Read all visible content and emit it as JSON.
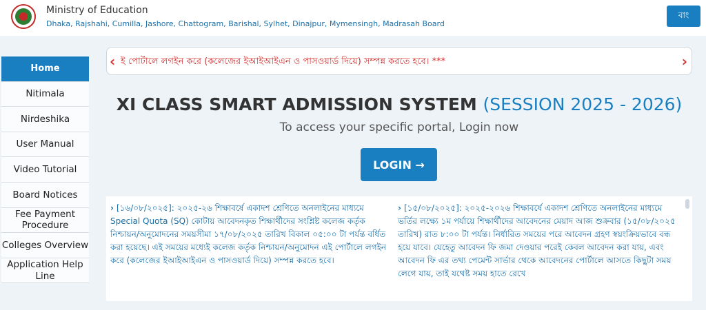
{
  "header": {
    "ministry": "Ministry of Education",
    "boards": "Dhaka, Rajshahi, Cumilla, Jashore, Chattogram, Barishal, Sylhet, Dinajpur, Mymensingh, Madrasah Board",
    "lang_button": "বাং"
  },
  "sidebar": {
    "items": [
      {
        "label": "Home"
      },
      {
        "label": "Nitimala"
      },
      {
        "label": "Nirdeshika"
      },
      {
        "label": "User Manual"
      },
      {
        "label": "Video Tutorial"
      },
      {
        "label": "Board Notices"
      },
      {
        "label": "Fee Payment Procedure"
      },
      {
        "label": "Colleges Overview"
      },
      {
        "label": "Application Help Line"
      }
    ]
  },
  "marquee": {
    "text": "ই পোর্টালে লগইন করে (কলেজের ইআইআইএন ও পাসওয়ার্ড দিয়ে) সম্পন্ন করতে হবে। ***"
  },
  "main": {
    "title": "XI CLASS SMART ADMISSION SYSTEM",
    "session": "(SESSION 2025 - 2026)",
    "subtitle": "To access your specific portal, Login now",
    "login_label": "LOGIN →"
  },
  "notices": [
    {
      "text": "[১৬/০৮/২০২৫]: ২০২৫-২৬ শিক্ষাবর্ষে একাদশ শ্রেণিতে অনলাইনের মাধ্যমে Special Quota (SQ) কোটায় আবেদনকৃত শিক্ষার্থীদের সংশ্লিষ্ট কলেজ কর্তৃক নিশ্চায়ন/অনুমোদনের সময়সীমা ১৭/০৮/২০২৫ তারিখ বিকাল ০৫:০০ টা পর্যন্ত বর্ধিত করা হয়েছে। এই সময়ের মধ্যেই কলেজ কর্তৃক নিশ্চায়ন/অনুমোদন এই পোর্টালে লগইন করে (কলেজের ইআইআইএন ও পাসওয়ার্ড দিয়ে) সম্পন্ন করতে হবে।"
    },
    {
      "text": "[১৫/০৮/২০২৫]: ২০২৫-২০২৬ শিক্ষাবর্ষে একাদশ শ্রেণিতে অনলাইনের মাধ্যমে ভর্তির লক্ষ্যে ১ম পর্যায়ে শিক্ষার্থীদের আবেদনের মেয়াদ আজ শুক্রবার (১৫/০৮/২০২৫ তারিখ) রাত ৮:০০ টা পর্যন্ত। নির্ধারিত সময়ের পরে আবেদন গ্রহণ স্বয়ংক্রিয়ভাবে বন্ধ হয়ে যাবে। যেহেতু আবেদন ফি জমা দেওয়ার পরেই কেবল আবেদন করা যায়, এবং আবেদন ফি এর তথ্য পেমেন্ট সার্ভার থেকে আবেদনের পোর্টালে আসতে কিছুটা সময় লেগে যায়, তাই যথেষ্ট সময় হাতে রেখে"
    }
  ],
  "colors": {
    "primary": "#1a7fc1",
    "alert": "#d32f2f",
    "background": "#eef3f8"
  }
}
